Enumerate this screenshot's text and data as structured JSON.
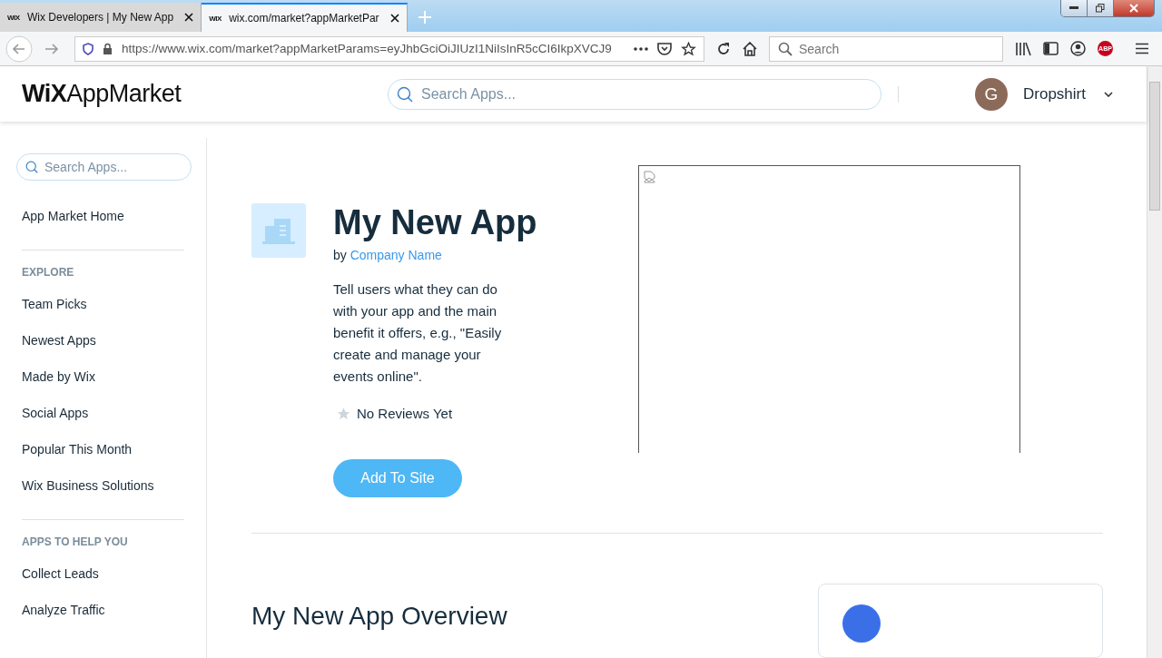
{
  "browser": {
    "tabs": [
      {
        "favicon": "WIX",
        "title": "Wix Developers | My New App",
        "selected": false
      },
      {
        "favicon": "WIX",
        "title": "wix.com/market?appMarketPar",
        "selected": true
      }
    ],
    "url": "https://www.wix.com/market?appMarketParams=eyJhbGciOiJIUzI1NiIsInR5cCI6IkpXVCJ9",
    "search_placeholder": "Search",
    "adblock_badge": "ABP"
  },
  "header": {
    "logo_bold": "WiX",
    "logo_light": "AppMarket",
    "search_placeholder": "Search Apps...",
    "avatar_initial": "G",
    "user": "Dropshirt"
  },
  "sidebar": {
    "search_placeholder": "Search Apps...",
    "home": "App Market Home",
    "sections": [
      {
        "title": "EXPLORE",
        "items": [
          "Team Picks",
          "Newest Apps",
          "Made by Wix",
          "Social Apps",
          "Popular This Month",
          "Wix Business Solutions"
        ]
      },
      {
        "title": "APPS TO HELP YOU",
        "items": [
          "Collect Leads",
          "Analyze Traffic"
        ]
      }
    ]
  },
  "app": {
    "name": "My New App",
    "by": "by",
    "company": "Company Name",
    "description": "Tell users what they can do with your app and the main benefit it offers, e.g., \"Easily create and manage your events online\".",
    "reviews": "No Reviews Yet",
    "button": "Add To Site",
    "overview_title": "My New App Overview"
  }
}
